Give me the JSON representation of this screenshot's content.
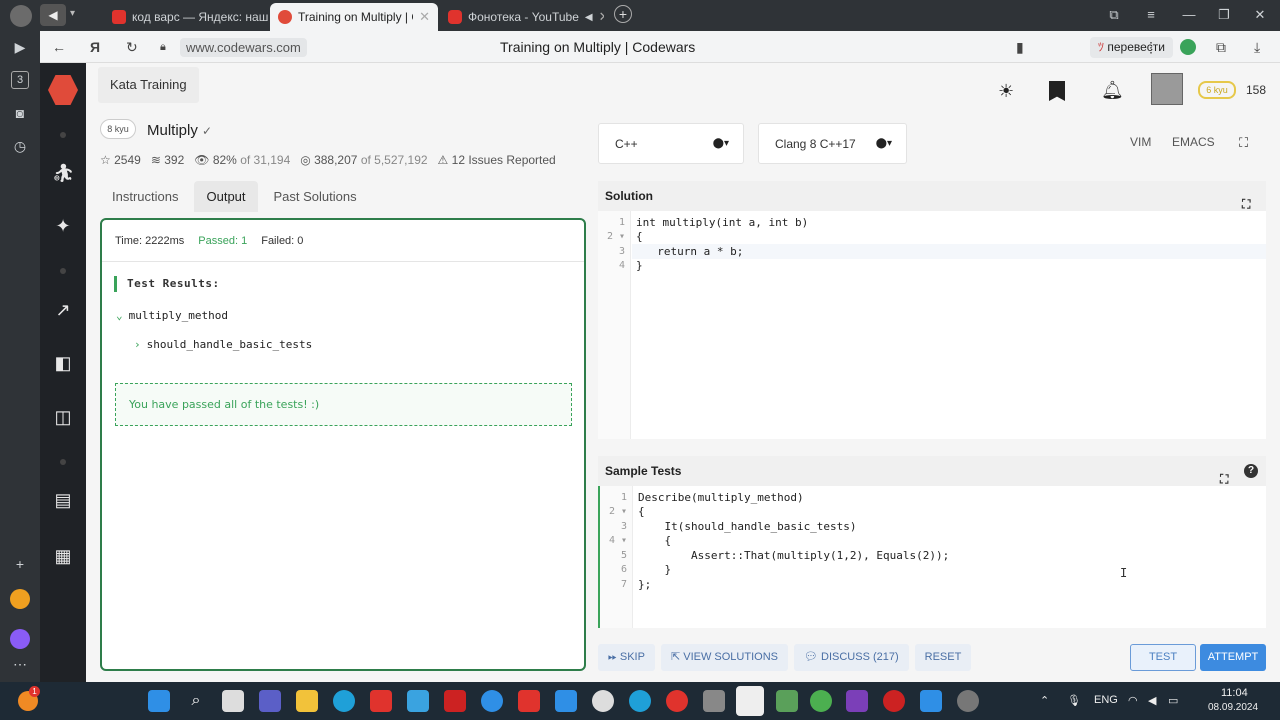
{
  "browser": {
    "tabs": [
      {
        "label": "код варс — Яндекс: нашл",
        "favicon": "yandex-icon",
        "active": false
      },
      {
        "label": "Training on Multiply | Cc",
        "favicon": "codewars-icon",
        "active": true
      },
      {
        "label": "Фонотека - YouTube",
        "favicon": "youtube-icon",
        "active": false
      }
    ],
    "url": "www.codewars.com",
    "page_title": "Training on Multiply | Codewars",
    "translate_label": "перевести",
    "side_badge": "3"
  },
  "header": {
    "kata_training_label": "Kata Training",
    "rank_badge": "6 kyu",
    "honor": "158"
  },
  "kata": {
    "kyu": "8 kyu",
    "title": "Multiply",
    "check": "✓",
    "stats": {
      "stars": "2549",
      "collections": "392",
      "satisfaction": "82%",
      "of1": "of 31,194",
      "completed": "388,207",
      "of2": "of 5,527,192",
      "issues": "12 Issues Reported"
    },
    "tabs": [
      "Instructions",
      "Output",
      "Past Solutions"
    ],
    "active_tab": "Output"
  },
  "output": {
    "time": "Time: 2222ms",
    "passed": "Passed: 1",
    "failed": "Failed: 0",
    "results_title": "Test Results:",
    "describe": "multiply_method",
    "it": "should_handle_basic_tests",
    "pass_message": "You have passed all of the tests! :)"
  },
  "editor": {
    "language": "C++",
    "version": "Clang 8 C++17",
    "modes": [
      "VIM",
      "EMACS"
    ],
    "solution_title": "Solution",
    "solution_lines": [
      "int multiply(int a, int b)",
      "{",
      "  return a * b;",
      "}"
    ],
    "tests_title": "Sample Tests",
    "test_lines": [
      "Describe(multiply_method)",
      "{",
      "    It(should_handle_basic_tests)",
      "    {",
      "        Assert::That(multiply(1,2), Equals(2));",
      "    }",
      "};"
    ]
  },
  "actions": {
    "skip": "SKIP",
    "view_solutions": "VIEW SOLUTIONS",
    "discuss": "DISCUSS (217)",
    "reset": "RESET",
    "test": "TEST",
    "attempt": "ATTEMPT"
  },
  "taskbar": {
    "lang": "ENG",
    "time": "11:04",
    "date": "08.09.2024",
    "notif_badge": "1"
  },
  "colors": {
    "accent_green": "#3aa35a",
    "codewars_red": "#e04b3a",
    "attempt_blue": "#3d8be0"
  }
}
